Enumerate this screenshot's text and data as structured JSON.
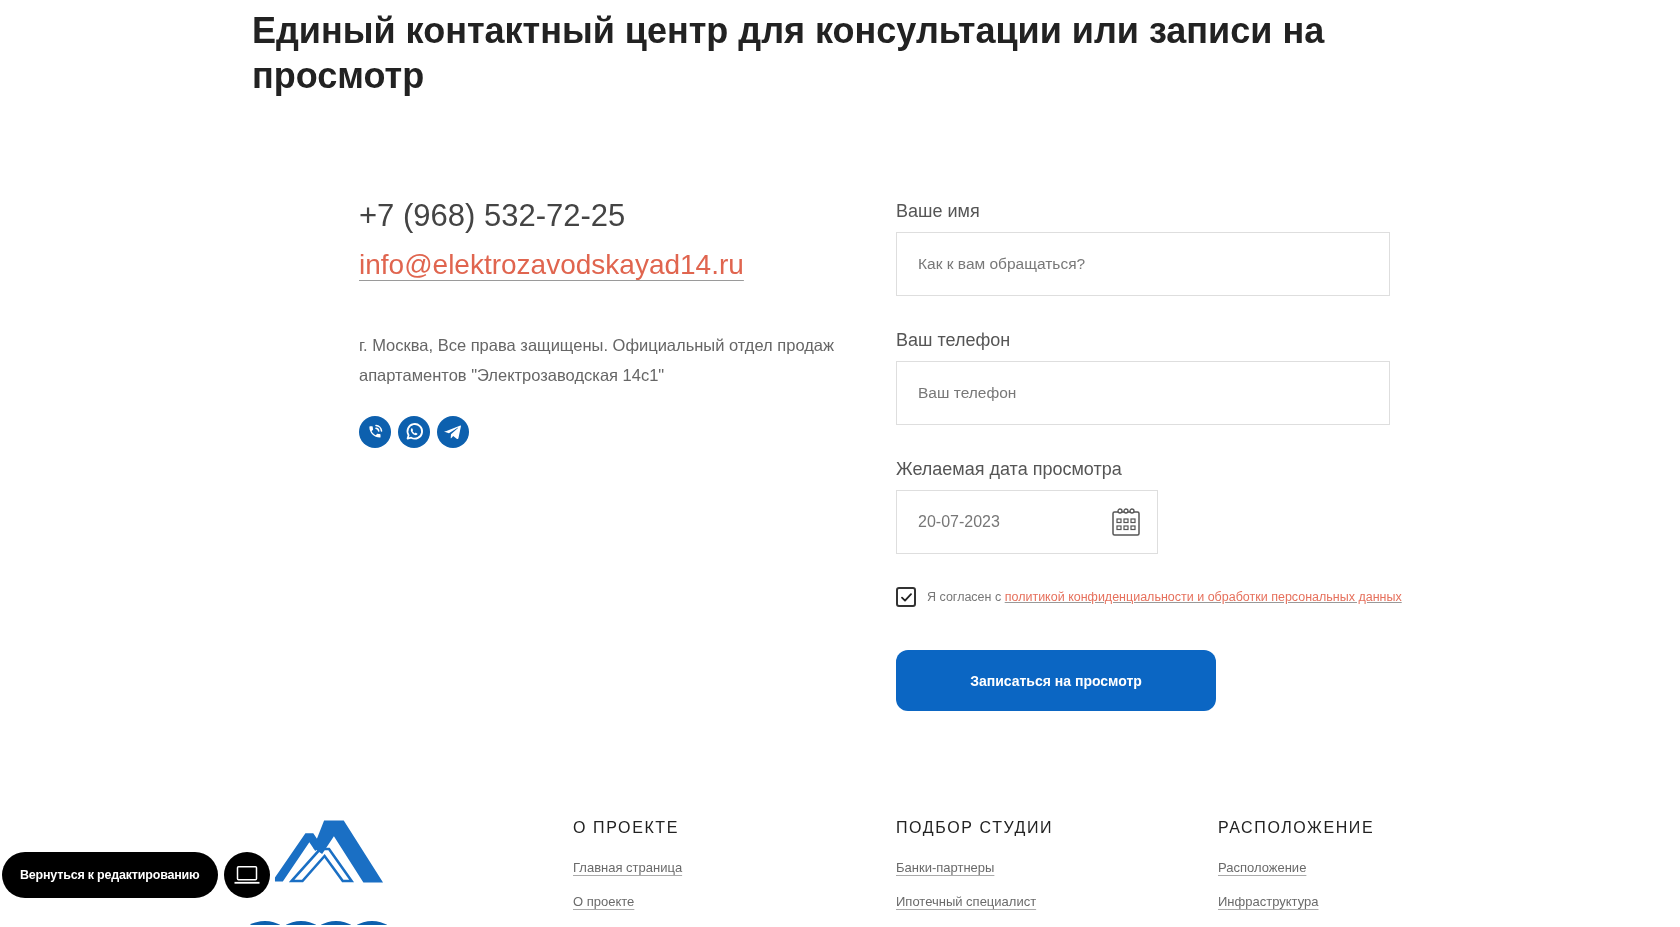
{
  "heading": "Единый контактный центр для консультации или записи на просмотр",
  "contacts": {
    "phone": "+7 (968) 532-72-25",
    "email": "info@elektrozavodskayad14.ru",
    "address": "г. Москва, Все права защищены. Официальный отдел продаж апартаментов \"Электрозаводская 14с1\""
  },
  "form": {
    "fields": [
      {
        "kind": "text",
        "label": "Ваше имя",
        "placeholder": "Как к вам обращаться?"
      },
      {
        "kind": "text",
        "label": "Ваш телефон",
        "placeholder": "Ваш телефон"
      },
      {
        "kind": "date",
        "label": "Желаемая дата просмотра",
        "value": "20-07-2023"
      }
    ],
    "consent": {
      "checked": true,
      "text": "Я согласен с",
      "link": "политикой конфиденциальности и обработки персональных данных"
    },
    "submit": "Записаться на просмотр"
  },
  "footer": {
    "columns": [
      {
        "title": "О ПРОЕКТЕ",
        "links": [
          "Главная страница",
          "О проекте"
        ]
      },
      {
        "title": "ПОДБОР СТУДИИ",
        "links": [
          "Банки-партнеры",
          "Ипотечный специалист"
        ]
      },
      {
        "title": "РАСПОЛОЖЕНИЕ",
        "links": [
          "Расположение",
          "Инфраструктура"
        ]
      }
    ]
  },
  "editor_bar": {
    "back_button": "Вернуться к редактированию"
  }
}
